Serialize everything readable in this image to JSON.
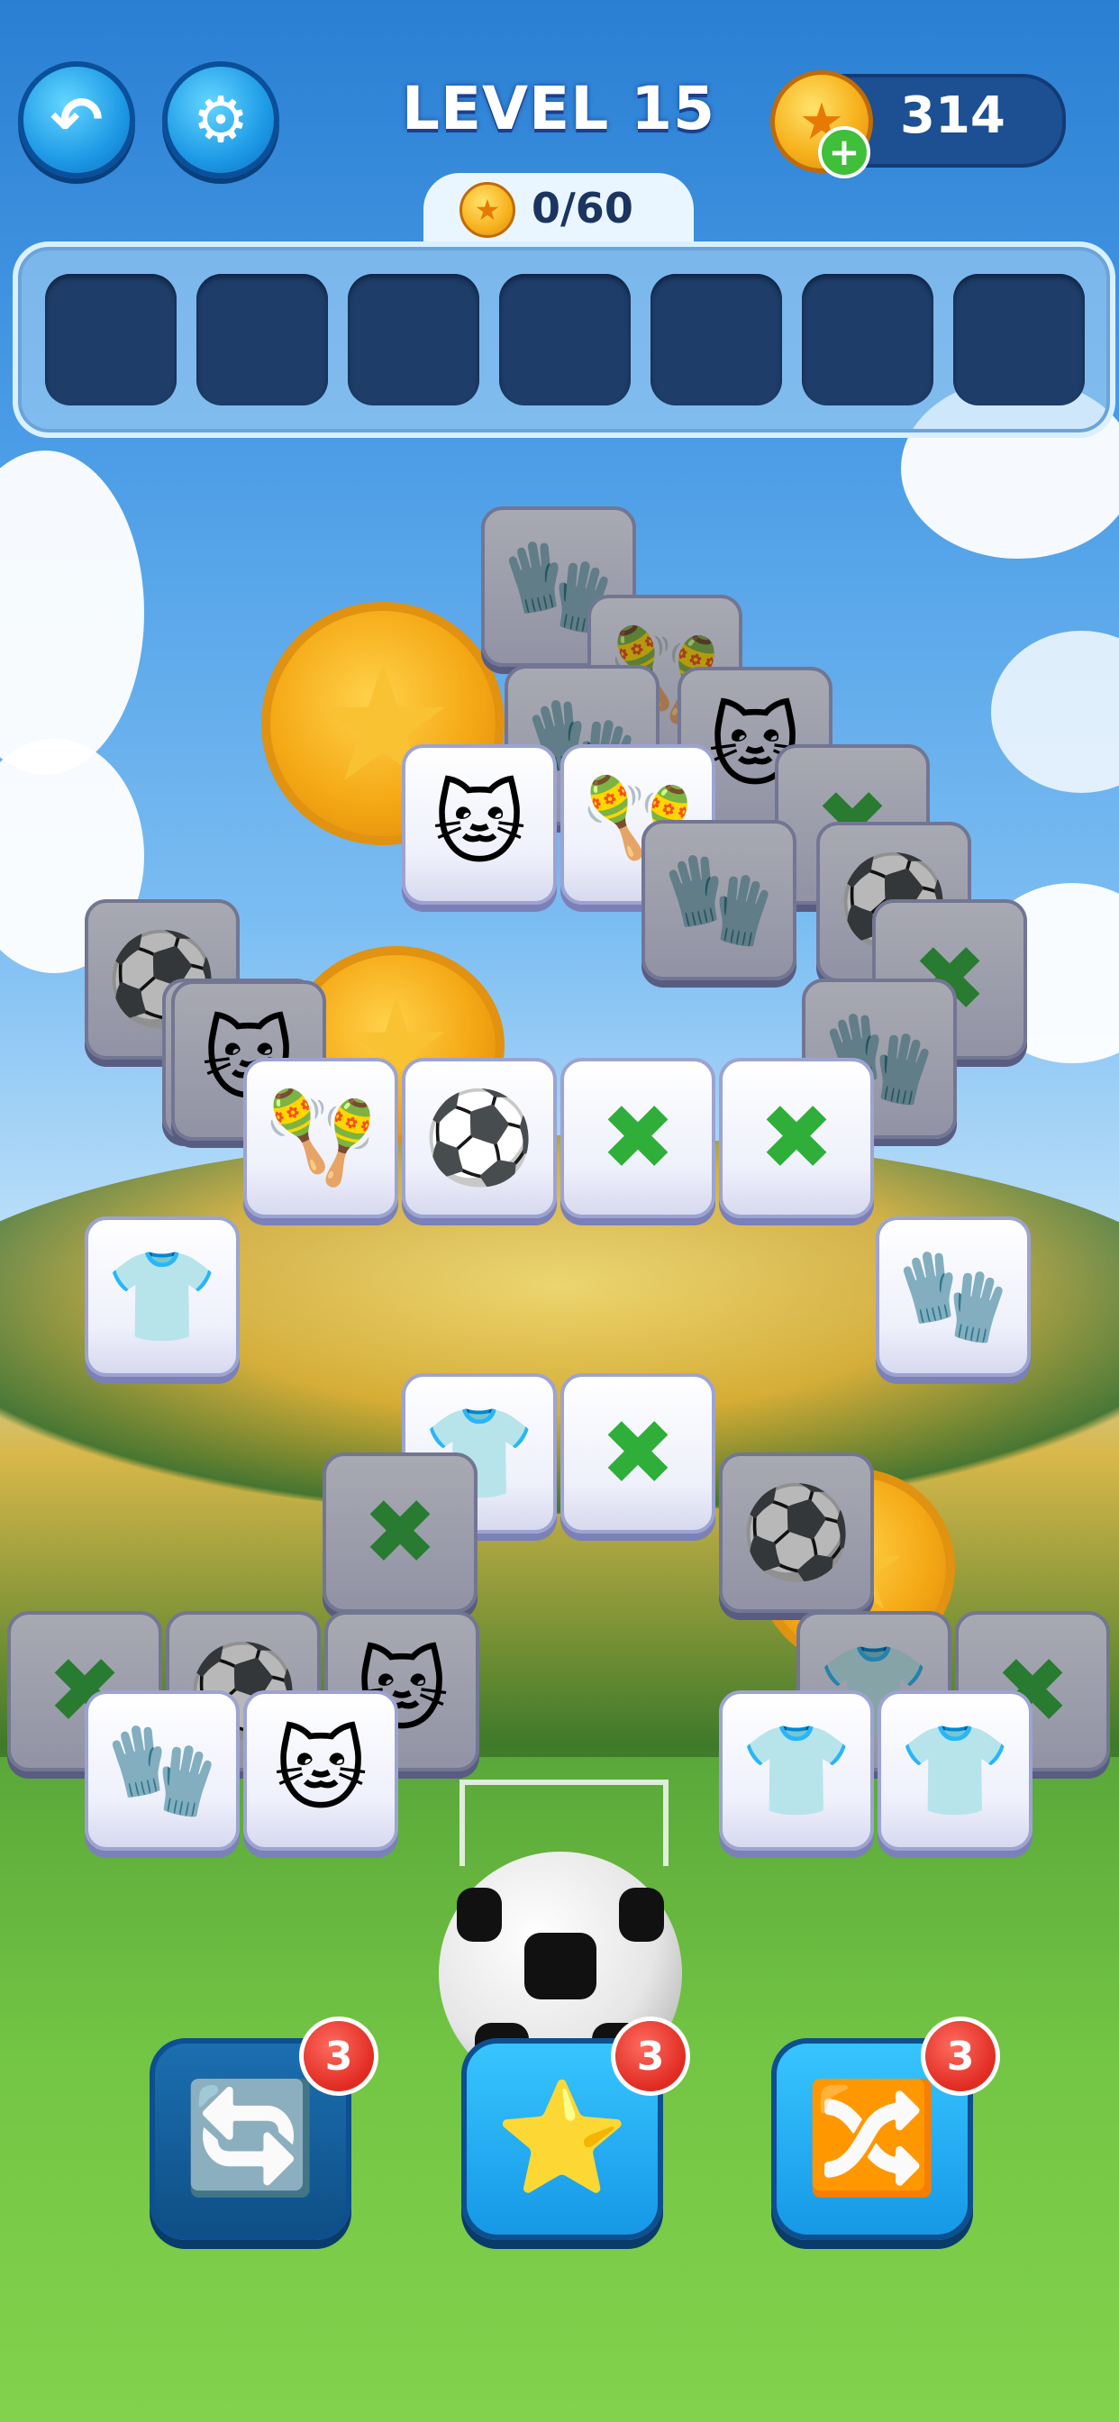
{
  "header": {
    "level_title": "LEVEL 15",
    "coin_count": "314",
    "progress": "0/60"
  },
  "tray": {
    "slots": 7
  },
  "icons": {
    "back": "undo-arrow-icon",
    "settings": "gear-icon",
    "coin": "star-coin-icon",
    "plus": "plus-icon"
  },
  "tile_legend": {
    "cat": "🐱",
    "maracas": "🪇",
    "gloves": "🧤",
    "ball": "⚽",
    "bones": "✖",
    "shirt": "👕"
  },
  "tiles": [
    {
      "type": "gloves",
      "top": false
    },
    {
      "type": "maracas",
      "top": false
    },
    {
      "type": "cat",
      "top": false
    },
    {
      "type": "gloves",
      "top": false
    },
    {
      "type": "cat",
      "top": true
    },
    {
      "type": "maracas",
      "top": true
    },
    {
      "type": "bones",
      "top": false
    },
    {
      "type": "gloves",
      "top": false
    },
    {
      "type": "ball",
      "top": false
    },
    {
      "type": "bones",
      "top": false
    },
    {
      "type": "ball",
      "top": false
    },
    {
      "type": "bones",
      "top": false
    },
    {
      "type": "cat",
      "top": false
    },
    {
      "type": "gloves",
      "top": false
    },
    {
      "type": "maracas",
      "top": true
    },
    {
      "type": "ball",
      "top": true
    },
    {
      "type": "bones",
      "top": true
    },
    {
      "type": "bones",
      "top": true
    },
    {
      "type": "shirt",
      "top": true
    },
    {
      "type": "gloves",
      "top": true
    },
    {
      "type": "shirt",
      "top": true
    },
    {
      "type": "bones",
      "top": true
    },
    {
      "type": "bones",
      "top": false
    },
    {
      "type": "ball",
      "top": false
    },
    {
      "type": "bones",
      "top": false
    },
    {
      "type": "ball",
      "top": false
    },
    {
      "type": "cat",
      "top": false
    },
    {
      "type": "shirt",
      "top": false
    },
    {
      "type": "bones",
      "top": false
    },
    {
      "type": "gloves",
      "top": true
    },
    {
      "type": "cat",
      "top": true
    },
    {
      "type": "shirt",
      "top": true
    },
    {
      "type": "shirt",
      "top": true
    }
  ],
  "boosters": [
    {
      "name": "undo-tile",
      "icon": "🔄",
      "count": "3"
    },
    {
      "name": "magic-wand",
      "icon": "⭐",
      "count": "3"
    },
    {
      "name": "shuffle",
      "icon": "🔀",
      "count": "3"
    }
  ]
}
